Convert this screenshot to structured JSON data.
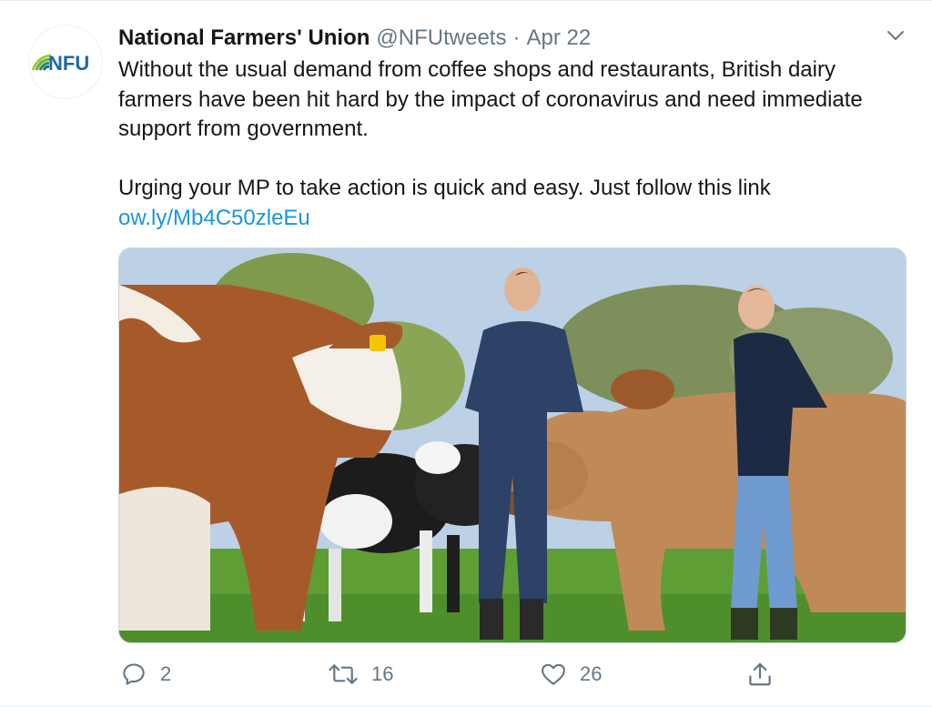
{
  "tweet": {
    "avatar_text": "NFU",
    "display_name": "National Farmers' Union",
    "handle": "@NFUtweets",
    "separator": "·",
    "date": "Apr 22",
    "paragraph1": "Without the usual demand from coffee shops and restaurants, British dairy farmers have been hit hard by the impact of coronavirus and need immediate support from government.",
    "paragraph2": "Urging your MP to take action is quick and easy. Just follow this link",
    "link_text": "ow.ly/Mb4C50zleEu"
  },
  "actions": {
    "reply_count": "2",
    "retweet_count": "16",
    "like_count": "26"
  },
  "icons": {
    "caret": "chevron-down-icon",
    "reply": "reply-icon",
    "retweet": "retweet-icon",
    "like": "heart-icon",
    "share": "share-icon"
  },
  "colors": {
    "text": "#14171a",
    "secondary": "#657786",
    "link": "#1b95e0",
    "nfu_green": "#6cb33f",
    "nfu_blue": "#1a6aa8"
  }
}
